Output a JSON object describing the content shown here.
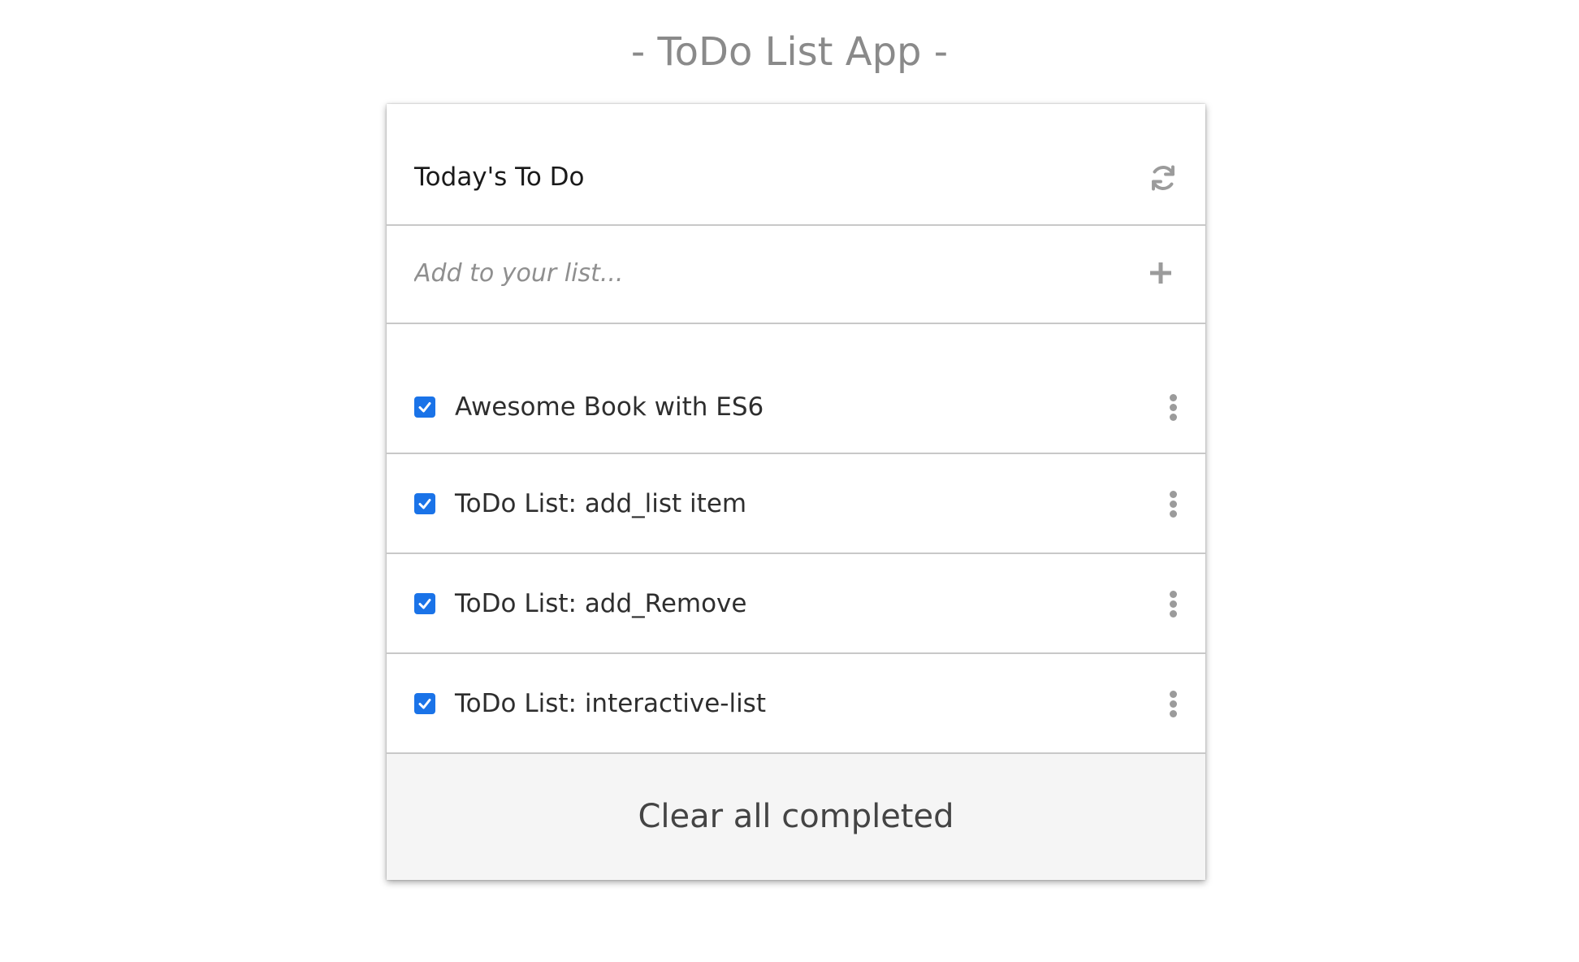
{
  "app": {
    "title": "- ToDo List App -"
  },
  "card": {
    "header_title": "Today's To Do",
    "refresh_icon": "refresh-icon",
    "add_placeholder": "Add to your list...",
    "add_value": "",
    "add_icon": "plus-icon"
  },
  "items": [
    {
      "label": "Awesome Book with ES6",
      "checked": true
    },
    {
      "label": "ToDo List: add_list item",
      "checked": true
    },
    {
      "label": "ToDo List: add_Remove",
      "checked": true
    },
    {
      "label": "ToDo List: interactive-list",
      "checked": true
    }
  ],
  "footer": {
    "clear_label": "Clear all completed"
  },
  "colors": {
    "accent": "#1a73e8",
    "title_gray": "#8a8a8a",
    "icon_gray": "#9b9b9b",
    "footer_bg": "#f5f5f5",
    "divider": "#c8c8c8"
  }
}
